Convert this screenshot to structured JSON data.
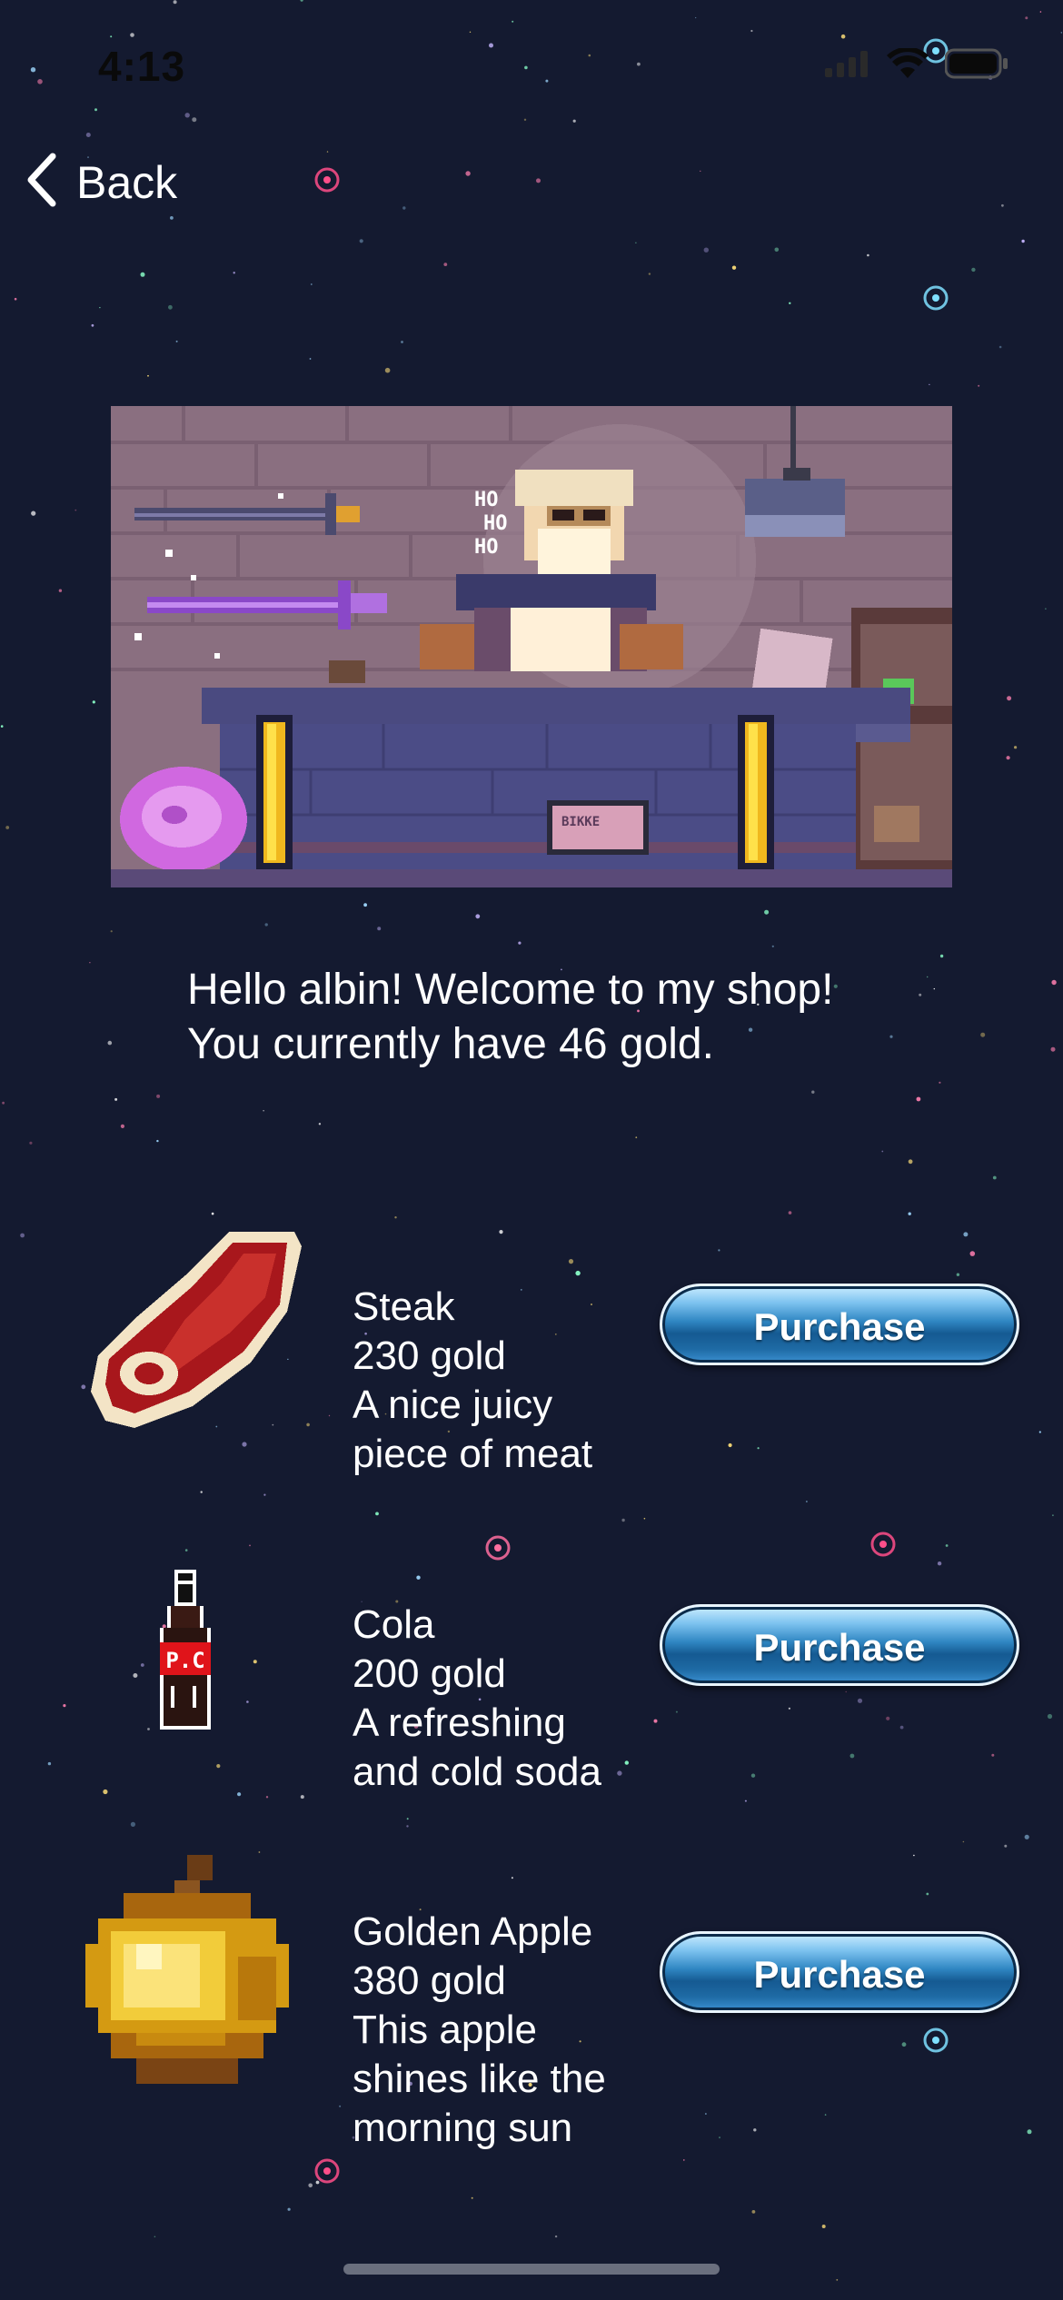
{
  "status_bar": {
    "time": "4:13"
  },
  "nav": {
    "back_label": "Back"
  },
  "colors": {
    "background": "#141a30",
    "button_blue": "#2f86c2",
    "text": "#ffffff"
  },
  "shop": {
    "greeting_line1": "Hello albin! Welcome to my shop!",
    "greeting_line2": "You currently have 46 gold.",
    "items": [
      {
        "name": "Steak",
        "price": "230 gold",
        "desc_line1": "A nice juicy",
        "desc_line2": "piece of meat",
        "icon": "steak-icon",
        "button_label": "Purchase"
      },
      {
        "name": "Cola",
        "price": "200 gold",
        "desc_line1": "A refreshing",
        "desc_line2": "and cold soda",
        "icon": "cola-bottle-icon",
        "bottle_label": "P.C",
        "button_label": "Purchase"
      },
      {
        "name": "Golden Apple",
        "price": "380 gold",
        "desc_line1": "This apple",
        "desc_line2": "shines like the",
        "desc_line3": "morning sun",
        "icon": "golden-apple-icon",
        "button_label": "Purchase"
      }
    ]
  },
  "scene": {
    "speech": [
      "HO",
      "HO",
      "HO"
    ],
    "sign_text": "BIKKE"
  }
}
